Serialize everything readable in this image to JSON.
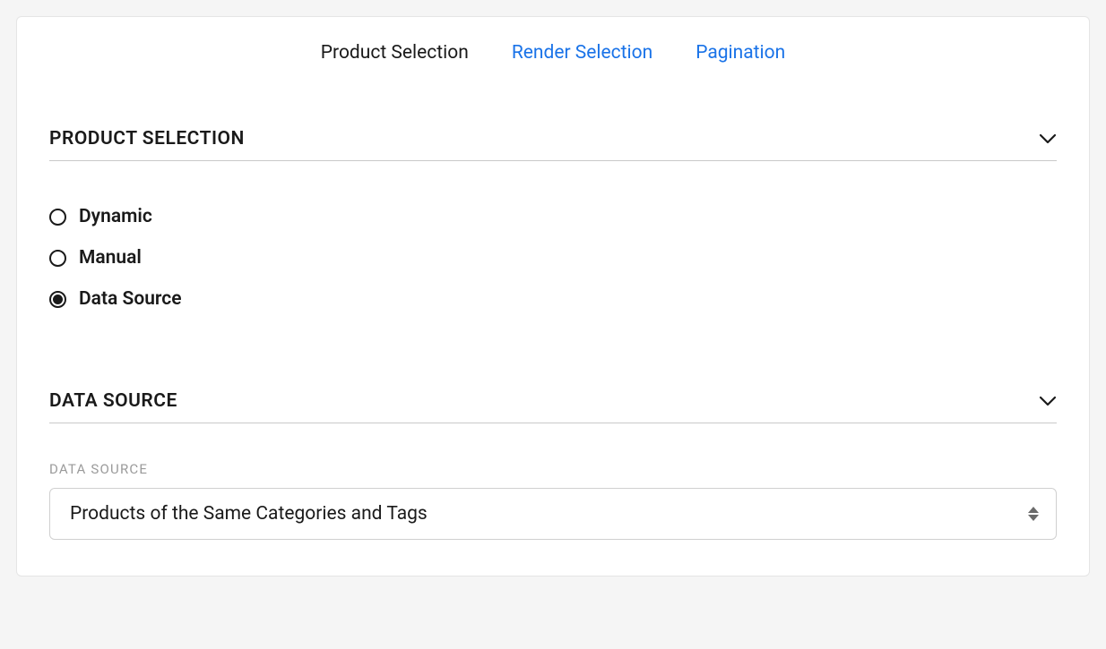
{
  "tabs": {
    "items": [
      {
        "label": "Product Selection",
        "active": true
      },
      {
        "label": "Render Selection",
        "active": false
      },
      {
        "label": "Pagination",
        "active": false
      }
    ]
  },
  "sections": {
    "product_selection": {
      "title": "PRODUCT SELECTION",
      "radio_options": [
        {
          "label": "Dynamic",
          "selected": false
        },
        {
          "label": "Manual",
          "selected": false
        },
        {
          "label": "Data Source",
          "selected": true
        }
      ]
    },
    "data_source": {
      "title": "DATA SOURCE",
      "field_label": "DATA SOURCE",
      "selected_value": "Products of the Same Categories and Tags"
    }
  }
}
